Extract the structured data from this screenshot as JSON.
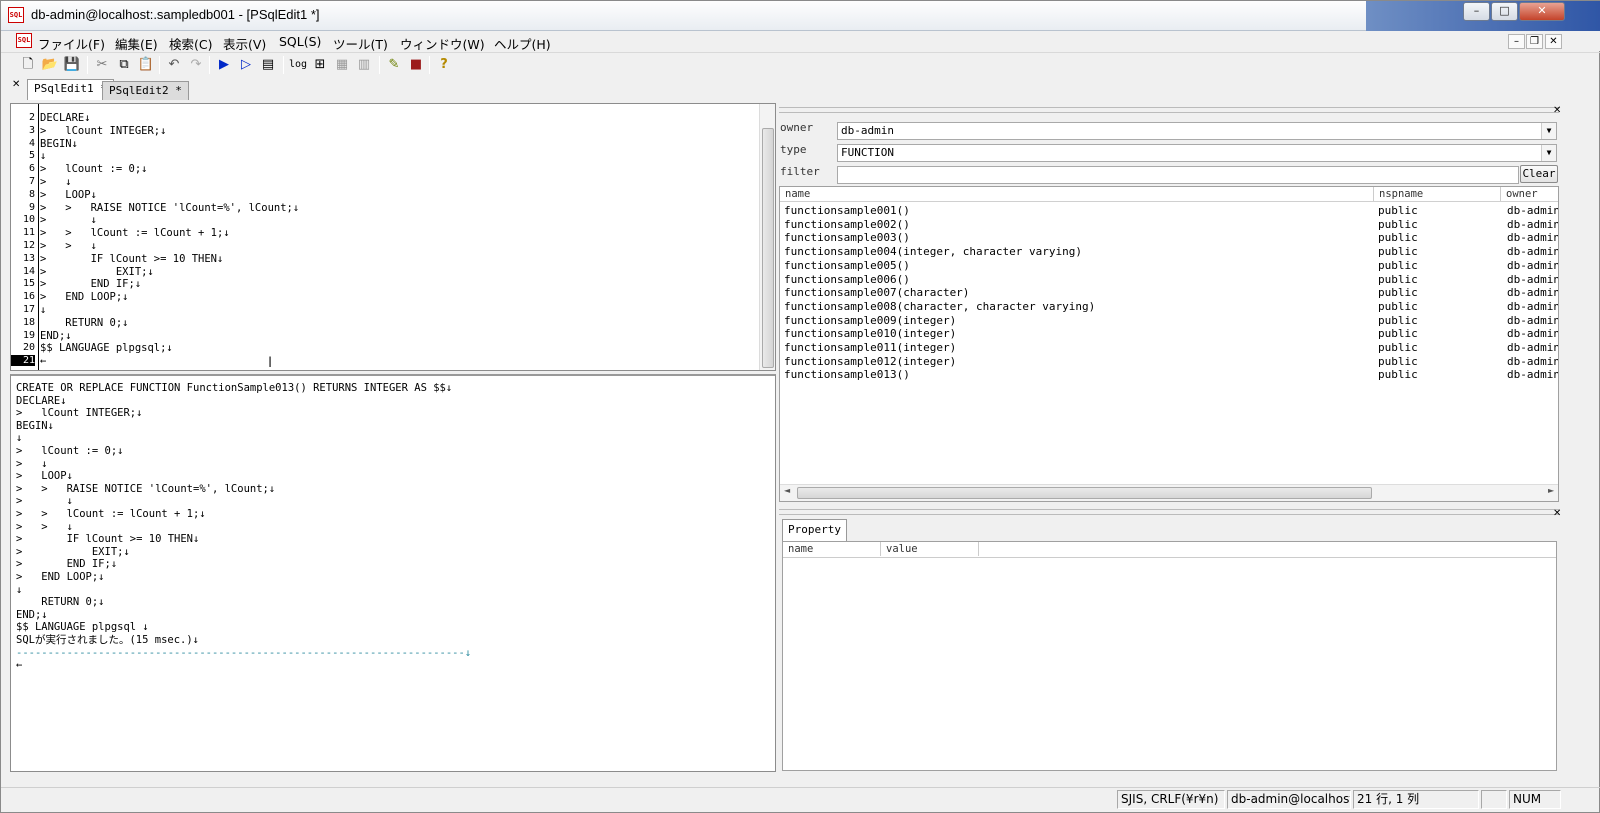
{
  "window": {
    "title": "db-admin@localhost:.sampledb001 - [PSqlEdit1 *]",
    "app_icon": "SQL",
    "controls": {
      "minimize": "–",
      "maximize": "□",
      "close": "✕"
    }
  },
  "menu": [
    "ファイル(F)",
    "編集(E)",
    "検索(C)",
    "表示(V)",
    "SQL(S)",
    "ツール(T)",
    "ウィンドウ(W)",
    "ヘルプ(H)"
  ],
  "mdi_controls": {
    "minimize": "–",
    "restore": "❐",
    "close": "✕"
  },
  "toolbar": {
    "log_label": "log"
  },
  "tabs": [
    {
      "label": "PSqlEdit1 *",
      "active": true
    },
    {
      "label": "PSqlEdit2 *",
      "active": false
    }
  ],
  "editor": {
    "lines": [
      {
        "n": "2",
        "t": "DECLARE↓"
      },
      {
        "n": "3",
        "t": ">   lCount INTEGER;↓"
      },
      {
        "n": "4",
        "t": "BEGIN↓"
      },
      {
        "n": "5",
        "t": "↓"
      },
      {
        "n": "6",
        "t": ">   lCount := 0;↓"
      },
      {
        "n": "7",
        "t": ">   ↓"
      },
      {
        "n": "8",
        "t": ">   LOOP↓"
      },
      {
        "n": "9",
        "t": ">   >   RAISE NOTICE 'lCount=%', lCount;↓"
      },
      {
        "n": "10",
        "t": ">       ↓"
      },
      {
        "n": "11",
        "t": ">   >   lCount := lCount + 1;↓"
      },
      {
        "n": "12",
        "t": ">   >   ↓"
      },
      {
        "n": "13",
        "t": ">       IF lCount >= 10 THEN↓"
      },
      {
        "n": "14",
        "t": ">           EXIT;↓"
      },
      {
        "n": "15",
        "t": ">       END IF;↓"
      },
      {
        "n": "16",
        "t": ">   END LOOP;↓"
      },
      {
        "n": "17",
        "t": "↓"
      },
      {
        "n": "18",
        "t": "    RETURN 0;↓"
      },
      {
        "n": "19",
        "t": "END;↓"
      },
      {
        "n": "20",
        "t": "$$ LANGUAGE plpgsql;↓"
      },
      {
        "n": "21",
        "t": "←"
      }
    ]
  },
  "output": {
    "lines": [
      "CREATE OR REPLACE FUNCTION FunctionSample013() RETURNS INTEGER AS $$↓",
      "DECLARE↓",
      ">   lCount INTEGER;↓",
      "BEGIN↓",
      "↓",
      ">   lCount := 0;↓",
      ">   ↓",
      ">   LOOP↓",
      ">   >   RAISE NOTICE 'lCount=%', lCount;↓",
      ">       ↓",
      ">   >   lCount := lCount + 1;↓",
      ">   >   ↓",
      ">       IF lCount >= 10 THEN↓",
      ">           EXIT;↓",
      ">       END IF;↓",
      ">   END LOOP;↓",
      "↓",
      "    RETURN 0;↓",
      "END;↓",
      "$$ LANGUAGE plpgsql ↓",
      "SQLが実行されました。(15 msec.)↓",
      "-----------------------------------------------------------------------↓",
      "←"
    ]
  },
  "object_browser": {
    "owner_label": "owner",
    "owner_value": "db-admin",
    "type_label": "type",
    "type_value": "FUNCTION",
    "filter_label": "filter",
    "filter_value": "",
    "clear_button": "Clear",
    "columns": [
      "name",
      "nspname",
      "owner"
    ],
    "rows": [
      [
        "functionsample001()",
        "public",
        "db-admin"
      ],
      [
        "functionsample002()",
        "public",
        "db-admin"
      ],
      [
        "functionsample003()",
        "public",
        "db-admin"
      ],
      [
        "functionsample004(integer, character varying)",
        "public",
        "db-admin"
      ],
      [
        "functionsample005()",
        "public",
        "db-admin"
      ],
      [
        "functionsample006()",
        "public",
        "db-admin"
      ],
      [
        "functionsample007(character)",
        "public",
        "db-admin"
      ],
      [
        "functionsample008(character, character varying)",
        "public",
        "db-admin"
      ],
      [
        "functionsample009(integer)",
        "public",
        "db-admin"
      ],
      [
        "functionsample010(integer)",
        "public",
        "db-admin"
      ],
      [
        "functionsample011(integer)",
        "public",
        "db-admin"
      ],
      [
        "functionsample012(integer)",
        "public",
        "db-admin"
      ],
      [
        "functionsample013()",
        "public",
        "db-admin"
      ]
    ]
  },
  "property": {
    "tab": "Property",
    "columns": [
      "name",
      "value"
    ]
  },
  "statusbar": {
    "encoding": "SJIS, CRLF(¥r¥n)",
    "connection": "db-admin@localhost:",
    "position": "21 行, 1 列",
    "num": "NUM"
  }
}
